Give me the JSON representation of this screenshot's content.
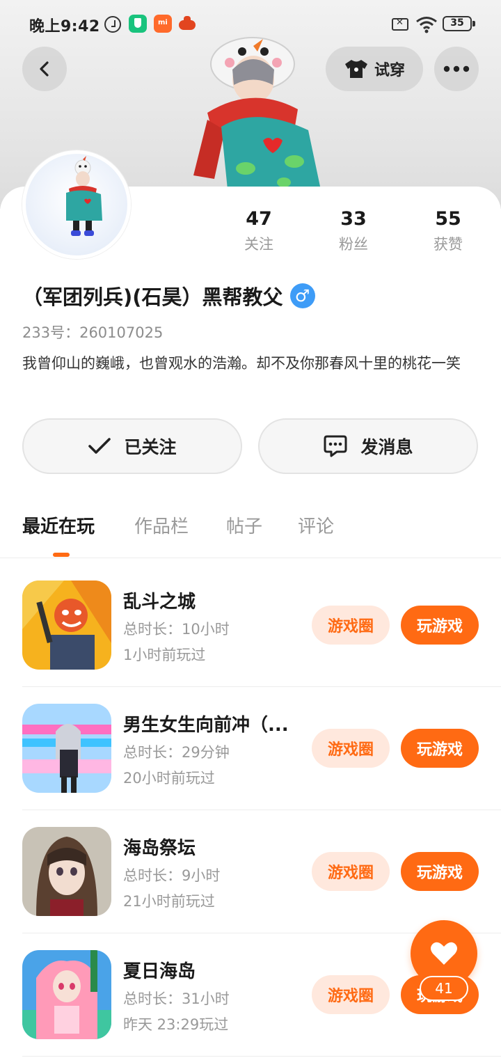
{
  "status_bar": {
    "time": "晚上9:42",
    "battery": "35",
    "icons": [
      "alarm-icon",
      "security-shield-icon",
      "mi-store-icon",
      "game-center-icon",
      "sim-off-icon",
      "wifi-icon",
      "battery-icon"
    ]
  },
  "header": {
    "try_on_label": "试穿"
  },
  "profile": {
    "stats": [
      {
        "value": "47",
        "label": "关注"
      },
      {
        "value": "33",
        "label": "粉丝"
      },
      {
        "value": "55",
        "label": "获赞"
      }
    ],
    "username": "（军团列兵)(石昊）黑帮教父",
    "gender_symbol": "♂",
    "id_text": "233号：260107025",
    "bio": "我曾仰山的巍峨，也曾观水的浩瀚。却不及你那春风十里的桃花一笑"
  },
  "actions": {
    "follow_label": "已关注",
    "message_label": "发消息"
  },
  "tabs": [
    {
      "label": "最近在玩",
      "active": true
    },
    {
      "label": "作品栏",
      "active": false
    },
    {
      "label": "帖子",
      "active": false
    },
    {
      "label": "评论",
      "active": false
    }
  ],
  "games": [
    {
      "title": "乱斗之城",
      "duration": "总时长：10小时",
      "last_played": "1小时前玩过",
      "circle_label": "游戏圈",
      "play_label": "玩游戏"
    },
    {
      "title": "男生女生向前冲（...",
      "duration": "总时长：29分钟",
      "last_played": "20小时前玩过",
      "circle_label": "游戏圈",
      "play_label": "玩游戏"
    },
    {
      "title": "海岛祭坛",
      "duration": "总时长：9小时",
      "last_played": "21小时前玩过",
      "circle_label": "游戏圈",
      "play_label": "玩游戏"
    },
    {
      "title": "夏日海岛",
      "duration": "总时长：31小时",
      "last_played": "昨天 23:29玩过",
      "circle_label": "游戏圈",
      "play_label": "玩游戏"
    }
  ],
  "like_fab": {
    "count": "41"
  },
  "colors": {
    "accent": "#ff6a13",
    "accent_light": "#ffe8dd",
    "gender_blue": "#3e9cf7"
  }
}
